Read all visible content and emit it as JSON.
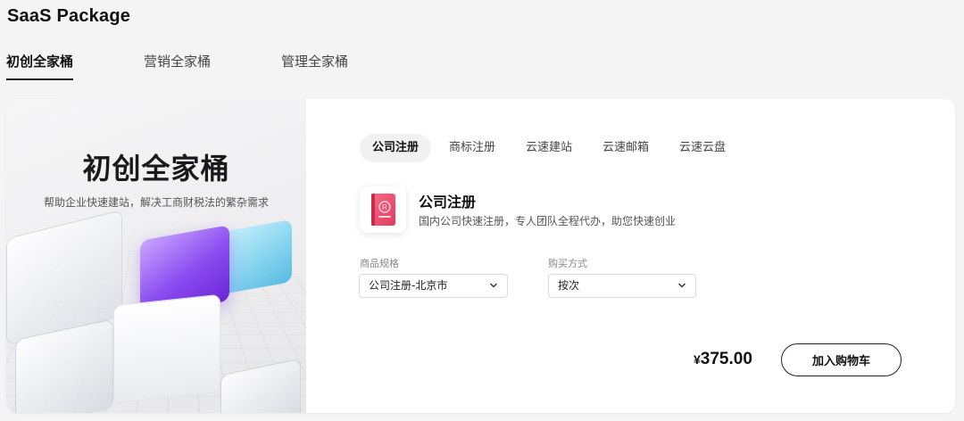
{
  "page": {
    "title": "SaaS Package"
  },
  "tabs": [
    {
      "label": "初创全家桶",
      "active": true
    },
    {
      "label": "营销全家桶",
      "active": false
    },
    {
      "label": "管理全家桶",
      "active": false
    }
  ],
  "hero": {
    "title": "初创全家桶",
    "subtitle": "帮助企业快速建站，解决工商财税法的繁杂需求"
  },
  "sub_tabs": [
    {
      "label": "公司注册",
      "active": true
    },
    {
      "label": "商标注册",
      "active": false
    },
    {
      "label": "云速建站",
      "active": false
    },
    {
      "label": "云速邮箱",
      "active": false
    },
    {
      "label": "云速云盘",
      "active": false
    }
  ],
  "product": {
    "name": "公司注册",
    "description": "国内公司快速注册，专人团队全程代办，助您快速创业",
    "icon": "registration-book-icon",
    "icon_color": "#e84a6a"
  },
  "spec_select": {
    "label": "商品规格",
    "value": "公司注册-北京市"
  },
  "purchase_select": {
    "label": "购买方式",
    "value": "按次"
  },
  "price": {
    "currency": "¥",
    "amount": "375.00"
  },
  "cart_button": {
    "label": "加入购物车"
  },
  "colors": {
    "accent_purple": "#8a4bf0",
    "accent_cyan": "#77cfee",
    "product_red": "#e84a6a"
  }
}
